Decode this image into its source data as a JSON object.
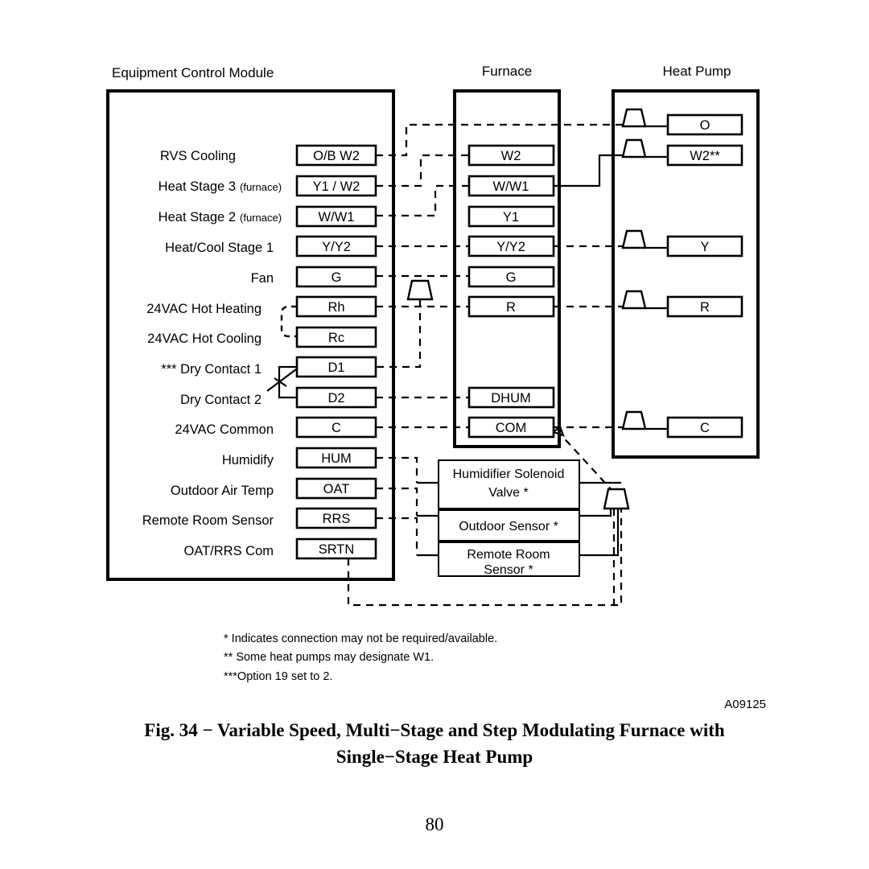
{
  "headers": {
    "ecm": "Equipment Control Module",
    "furnace": "Furnace",
    "heatpump": "Heat Pump"
  },
  "ecm_rows": [
    {
      "label": "RVS Cooling",
      "sub": "",
      "terminal": "O/B W2"
    },
    {
      "label": "Heat Stage 3",
      "sub": "(furnace)",
      "terminal": "Y1 / W2"
    },
    {
      "label": "Heat Stage 2",
      "sub": "(furnace)",
      "terminal": "W/W1"
    },
    {
      "label": "Heat/Cool Stage 1",
      "sub": "",
      "terminal": "Y/Y2"
    },
    {
      "label": "Fan",
      "sub": "",
      "terminal": "G"
    },
    {
      "label": "24VAC Hot Heating",
      "sub": "",
      "terminal": "Rh"
    },
    {
      "label": "24VAC Hot Cooling",
      "sub": "",
      "terminal": "Rc"
    },
    {
      "label": "*** Dry Contact 1",
      "sub": "",
      "terminal": "D1"
    },
    {
      "label": "Dry Contact 2",
      "sub": "",
      "terminal": "D2"
    },
    {
      "label": "24VAC Common",
      "sub": "",
      "terminal": "C"
    },
    {
      "label": "Humidify",
      "sub": "",
      "terminal": "HUM"
    },
    {
      "label": "Outdoor Air Temp",
      "sub": "",
      "terminal": "OAT"
    },
    {
      "label": "Remote Room Sensor",
      "sub": "",
      "terminal": "RRS"
    },
    {
      "label": "OAT/RRS Com",
      "sub": "",
      "terminal": "SRTN"
    }
  ],
  "furnace_terminals": [
    {
      "terminal": "W2",
      "row": 0
    },
    {
      "terminal": "W/W1",
      "row": 1
    },
    {
      "terminal": "Y1",
      "row": 2
    },
    {
      "terminal": "Y/Y2",
      "row": 3
    },
    {
      "terminal": "G",
      "row": 4
    },
    {
      "terminal": "R",
      "row": 5
    },
    {
      "terminal": "DHUM",
      "row": 8
    },
    {
      "terminal": "COM",
      "row": 9
    }
  ],
  "heatpump_terminals": [
    {
      "terminal": "O",
      "row": 0
    },
    {
      "terminal": "W2**",
      "row": 1
    },
    {
      "terminal": "Y",
      "row": 3
    },
    {
      "terminal": "R",
      "row": 5
    },
    {
      "terminal": "C",
      "row": 9
    }
  ],
  "accessory_boxes": [
    {
      "line1": "Humidifier Solenoid",
      "line2": "Valve  *"
    },
    {
      "line1": "Outdoor Sensor *",
      "line2": ""
    },
    {
      "line1": "Remote Room",
      "line2": "Sensor *"
    }
  ],
  "notes": [
    "*   Indicates connection may not be required/available.",
    "** Some heat pumps may designate W1.",
    "***Option 19 set to 2."
  ],
  "part_number": "A09125",
  "caption": {
    "line1": "Fig. 34 −  Variable Speed, Multi−Stage and Step Modulating Furnace with",
    "line2": "Single−Stage Heat Pump"
  },
  "page_number": "80",
  "colors": {
    "ink": "#000000",
    "paper": "#ffffff"
  }
}
